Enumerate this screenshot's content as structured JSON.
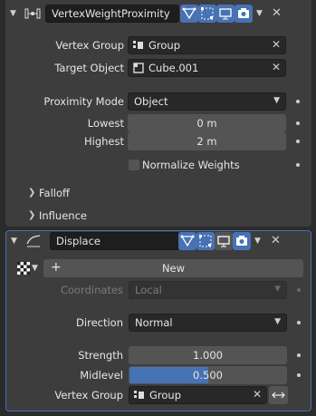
{
  "mod1": {
    "name": "VertexWeightProximity",
    "vertex_group_label": "Vertex Group",
    "vertex_group_value": "Group",
    "target_object_label": "Target Object",
    "target_object_value": "Cube.001",
    "proximity_mode_label": "Proximity Mode",
    "proximity_mode_value": "Object",
    "lowest_label": "Lowest",
    "lowest_value": "0 m",
    "highest_label": "Highest",
    "highest_value": "2 m",
    "normalize_label": "Normalize Weights",
    "normalize_checked": false,
    "falloff_label": "Falloff",
    "influence_label": "Influence"
  },
  "mod2": {
    "name": "Displace",
    "new_label": "New",
    "coordinates_label": "Coordinates",
    "coordinates_value": "Local",
    "direction_label": "Direction",
    "direction_value": "Normal",
    "strength_label": "Strength",
    "strength_value": "1.000",
    "midlevel_label": "Midlevel",
    "midlevel_value": "0.500",
    "midlevel_fraction": 0.5,
    "vertex_group_label": "Vertex Group",
    "vertex_group_value": "Group"
  },
  "colors": {
    "accent": "#4772b3",
    "panel": "#3d3d3d",
    "background": "#2b2b2b"
  },
  "icons": [
    "chevron-down-icon",
    "vertex-weight-modifier-icon",
    "displace-modifier-icon",
    "edit-mode-icon",
    "cage-icon",
    "realtime-display-icon",
    "render-camera-icon",
    "close-icon",
    "vertex-group-icon",
    "object-icon",
    "texture-checker-icon",
    "plus-icon",
    "invert-arrows-icon",
    "chevron-right-icon"
  ]
}
